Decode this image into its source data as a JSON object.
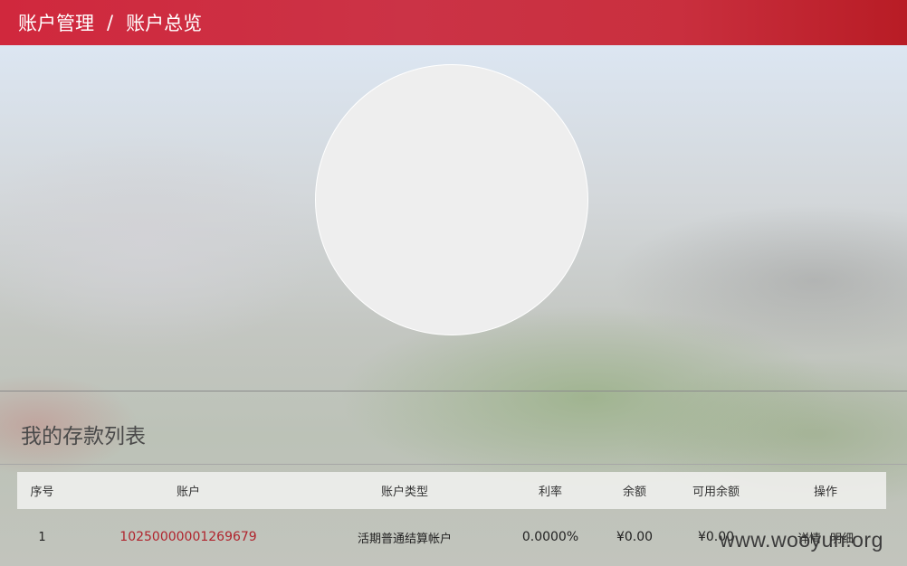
{
  "header": {
    "breadcrumb_parent": "账户管理",
    "separator": "/",
    "breadcrumb_current": "账户总览"
  },
  "section": {
    "title": "我的存款列表"
  },
  "table": {
    "columns": [
      "序号",
      "账户",
      "账户类型",
      "利率",
      "余额",
      "可用余额",
      "操作"
    ],
    "rows": [
      {
        "index": "1",
        "account": "10250000001269679",
        "type": "活期普通结算帐户",
        "rate": "0.0000%",
        "balance": "¥0.00",
        "available": "¥0.00",
        "action_detail": "详情",
        "action_statement": "明细"
      }
    ]
  },
  "watermark": "www.wooyun.org",
  "colors": {
    "header_red": "#cb3346",
    "account_link": "#b0242d"
  }
}
